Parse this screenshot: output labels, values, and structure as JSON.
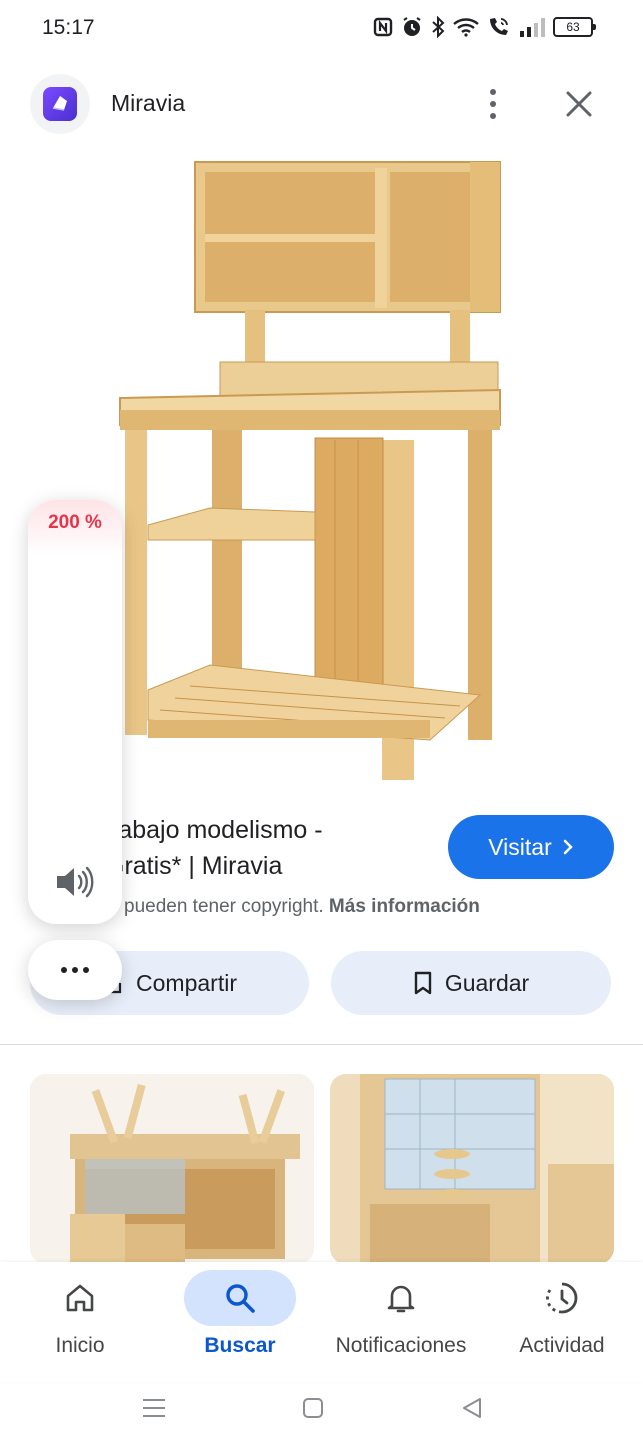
{
  "status_bar": {
    "time": "15:17",
    "battery": "63",
    "icons": [
      "nfc-icon",
      "alarm-icon",
      "bluetooth-icon",
      "wifi-icon",
      "wifi-call-icon",
      "signal-icon"
    ]
  },
  "header": {
    "app_name": "Miravia",
    "logo_icon": "miravia-logo-icon",
    "more_icon": "more-vert-icon",
    "close_icon": "close-icon"
  },
  "result": {
    "title_line1": "rabajo modelismo -",
    "title_line2": "Gratis* | Miravia",
    "visit_label": "Visitar",
    "copyright_text": "pueden tener copyright.",
    "more_info_label": "Más información"
  },
  "actions": {
    "share_label": "Compartir",
    "save_label": "Guardar"
  },
  "volume": {
    "level": "200 %"
  },
  "bottom_nav": {
    "items": [
      {
        "label": "Inicio",
        "icon": "home-icon"
      },
      {
        "label": "Buscar",
        "icon": "search-icon",
        "active": true
      },
      {
        "label": "Notificaciones",
        "icon": "bell-icon"
      },
      {
        "label": "Actividad",
        "icon": "activity-icon"
      }
    ]
  },
  "colors": {
    "accent": "#1a73e8",
    "chip_bg": "#e8eef9",
    "nav_active_bg": "#d3e3fd",
    "nav_active_text": "#0b57d0",
    "volume_level": "#e8344a",
    "wood": "#e8c585"
  }
}
